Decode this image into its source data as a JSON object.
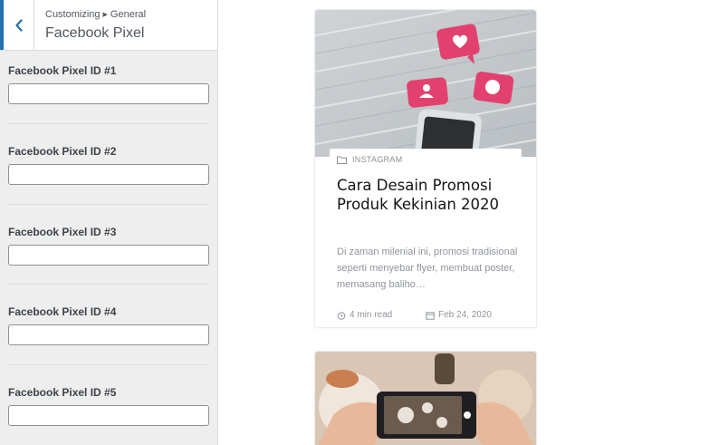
{
  "sidebar": {
    "breadcrumb": {
      "parent": "Customizing",
      "current": "General"
    },
    "section_title": "Facebook Pixel",
    "accent": "#2271b1",
    "fields": [
      {
        "label": "Facebook Pixel ID #1",
        "value": ""
      },
      {
        "label": "Facebook Pixel ID #2",
        "value": ""
      },
      {
        "label": "Facebook Pixel ID #3",
        "value": ""
      },
      {
        "label": "Facebook Pixel ID #4",
        "value": ""
      },
      {
        "label": "Facebook Pixel ID #5",
        "value": ""
      }
    ]
  },
  "preview": {
    "posts": [
      {
        "category": "INSTAGRAM",
        "title": "Cara Desain Promosi Produk Kekinian 2020",
        "excerpt": "Di zaman milenial ini, promosi tradisional seperti menyebar flyer, membuat poster, memasang baliho…",
        "read_time": "4 min read",
        "date": "Feb 24, 2020",
        "image": "social-notifications-phone-photo"
      },
      {
        "image": "phone-photographing-food-photo"
      }
    ]
  }
}
